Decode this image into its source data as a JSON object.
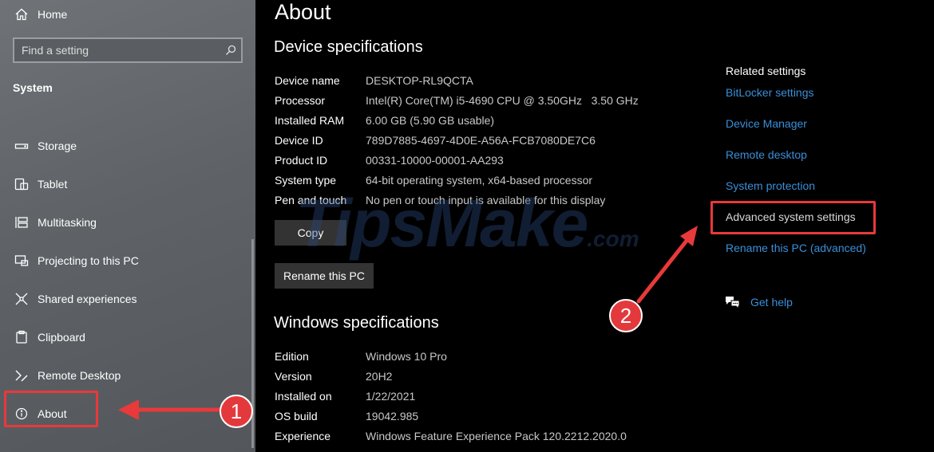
{
  "sidebar": {
    "home_label": "Home",
    "search_placeholder": "Find a setting",
    "section_label": "System",
    "items": [
      {
        "label": "Storage",
        "icon": "storage-icon"
      },
      {
        "label": "Tablet",
        "icon": "tablet-icon"
      },
      {
        "label": "Multitasking",
        "icon": "multitasking-icon"
      },
      {
        "label": "Projecting to this PC",
        "icon": "projecting-icon"
      },
      {
        "label": "Shared experiences",
        "icon": "shared-experiences-icon"
      },
      {
        "label": "Clipboard",
        "icon": "clipboard-icon"
      },
      {
        "label": "Remote Desktop",
        "icon": "remote-desktop-icon"
      },
      {
        "label": "About",
        "icon": "info-icon"
      }
    ]
  },
  "main": {
    "title": "About",
    "device_specs_title": "Device specifications",
    "device_specs": [
      {
        "key": "Device name",
        "value": "DESKTOP-RL9QCTA"
      },
      {
        "key": "Processor",
        "value": "Intel(R) Core(TM) i5-4690 CPU @ 3.50GHz   3.50 GHz"
      },
      {
        "key": "Installed RAM",
        "value": "6.00 GB (5.90 GB usable)"
      },
      {
        "key": "Device ID",
        "value": "789D7885-4697-4D0E-A56A-FCB7080DE7C6"
      },
      {
        "key": "Product ID",
        "value": "00331-10000-00001-AA293"
      },
      {
        "key": "System type",
        "value": "64-bit operating system, x64-based processor"
      },
      {
        "key": "Pen and touch",
        "value": "No pen or touch input is available for this display"
      }
    ],
    "copy_button": "Copy",
    "rename_button": "Rename this PC",
    "windows_specs_title": "Windows specifications",
    "windows_specs": [
      {
        "key": "Edition",
        "value": "Windows 10 Pro"
      },
      {
        "key": "Version",
        "value": "20H2"
      },
      {
        "key": "Installed on",
        "value": "1/22/2021"
      },
      {
        "key": "OS build",
        "value": "19042.985"
      },
      {
        "key": "Experience",
        "value": "Windows Feature Experience Pack 120.2212.2020.0"
      }
    ]
  },
  "related": {
    "title": "Related settings",
    "links": [
      "BitLocker settings",
      "Device Manager",
      "Remote desktop",
      "System protection",
      "Advanced system settings",
      "Rename this PC (advanced)"
    ],
    "get_help": "Get help"
  },
  "watermark": {
    "main": "TipsMake",
    "suffix": ".com"
  },
  "annotations": {
    "badge_1": "1",
    "badge_2": "2"
  },
  "colors": {
    "accent_link": "#3a8fd9",
    "highlight": "#e8393b"
  }
}
